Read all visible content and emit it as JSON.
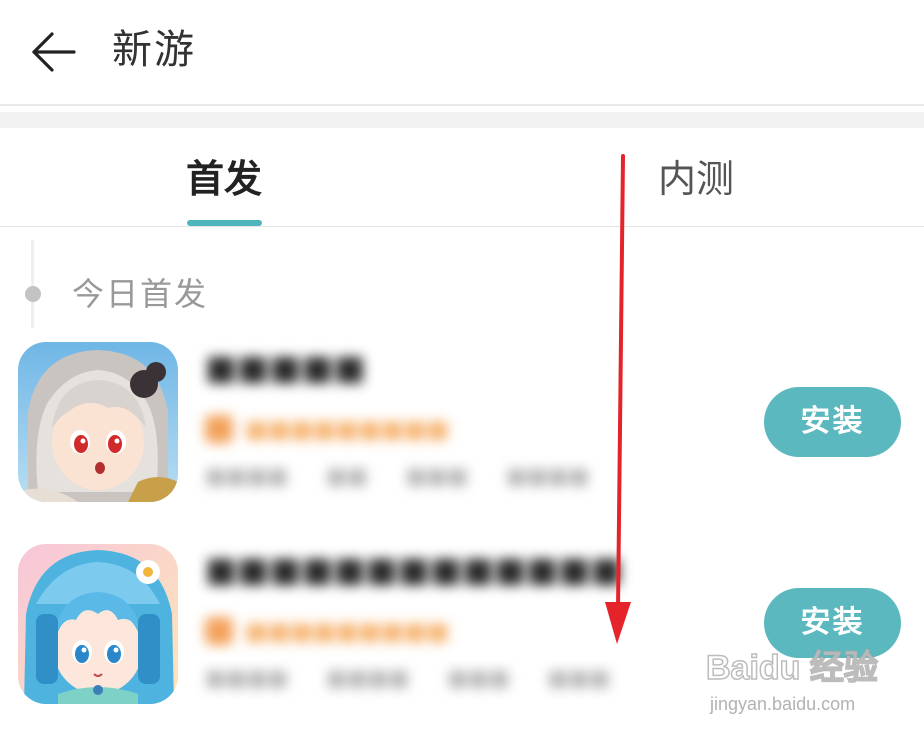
{
  "header": {
    "title": "新游",
    "back_icon": "arrow-left-icon"
  },
  "tabs": [
    {
      "label": "首发",
      "active": true
    },
    {
      "label": "内测",
      "active": false
    }
  ],
  "section": {
    "title": "今日首发"
  },
  "games": [
    {
      "name": "■■■■■",
      "tagline": "■■■■■■■■■",
      "meta": [
        "■■■■",
        "■■",
        "■■■",
        "■■■■"
      ],
      "install_label": "安装",
      "icon": "game-icon-silver-hair-girl"
    },
    {
      "name": "■■■■■■■■■■■■■",
      "tagline": "■■■■■■■■■",
      "meta": [
        "■■■■",
        "■■■■",
        "■■■",
        "■■■"
      ],
      "install_label": "安装",
      "icon": "game-icon-blue-hair-girl"
    }
  ],
  "watermark": {
    "main": "Baidu 经验",
    "sub": "jingyan.baidu.com"
  },
  "colors": {
    "accent": "#5bb8bf",
    "tab_indicator": "#4fb5bd",
    "annotation_arrow": "#e5232b"
  }
}
